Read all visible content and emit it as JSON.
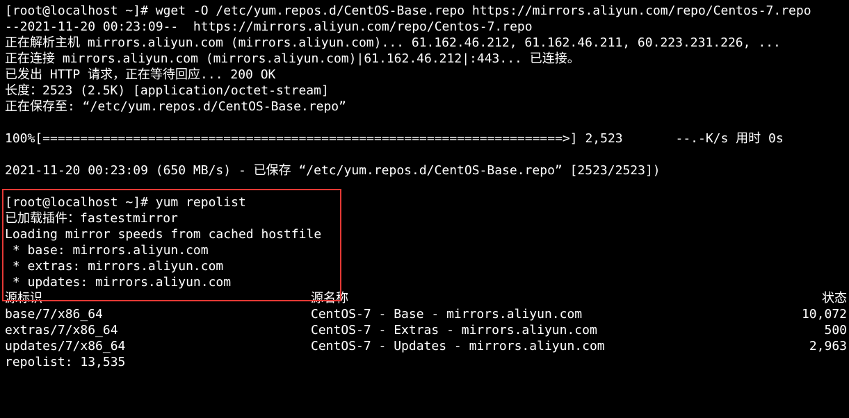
{
  "terminal": {
    "lines": {
      "wget_cmd": "[root@localhost ~]# wget -O /etc/yum.repos.d/CentOS-Base.repo https://mirrors.aliyun.com/repo/Centos-7.repo",
      "wget_start": "--2021-11-20 00:23:09--  https://mirrors.aliyun.com/repo/Centos-7.repo",
      "resolving": "正在解析主机 mirrors.aliyun.com (mirrors.aliyun.com)... 61.162.46.212, 61.162.46.211, 60.223.231.226, ...",
      "connecting": "正在连接 mirrors.aliyun.com (mirrors.aliyun.com)|61.162.46.212|:443... 已连接。",
      "http_request": "已发出 HTTP 请求，正在等待回应... 200 OK",
      "length": "长度：2523 (2.5K) [application/octet-stream]",
      "saving_to": "正在保存至: “/etc/yum.repos.d/CentOS-Base.repo”",
      "progress": "100%[=====================================================================>] 2,523       --.-K/s 用时 0s",
      "saved": "2021-11-20 00:23:09 (650 MB/s) - 已保存 “/etc/yum.repos.d/CentOS-Base.repo” [2523/2523])",
      "yum_cmd": "[root@localhost ~]# yum repolist",
      "plugins": "已加载插件：fastestmirror",
      "loading_mirror": "Loading mirror speeds from cached hostfile",
      "mirror_base": " * base: mirrors.aliyun.com",
      "mirror_extras": " * extras: mirrors.aliyun.com",
      "mirror_updates": " * updates: mirrors.aliyun.com",
      "repolist_total": "repolist: 13,535"
    },
    "repo_table": {
      "headers": {
        "id": "源标识",
        "name": "源名称",
        "status": "状态"
      },
      "rows": [
        {
          "id": "base/7/x86_64",
          "name": "CentOS-7 - Base - mirrors.aliyun.com",
          "status": "10,072"
        },
        {
          "id": "extras/7/x86_64",
          "name": "CentOS-7 - Extras - mirrors.aliyun.com",
          "status": "500"
        },
        {
          "id": "updates/7/x86_64",
          "name": "CentOS-7 - Updates - mirrors.aliyun.com",
          "status": "2,963"
        }
      ]
    },
    "colors": {
      "background": "#000000",
      "text": "#ffffff",
      "highlight_border": "#e53935"
    }
  }
}
